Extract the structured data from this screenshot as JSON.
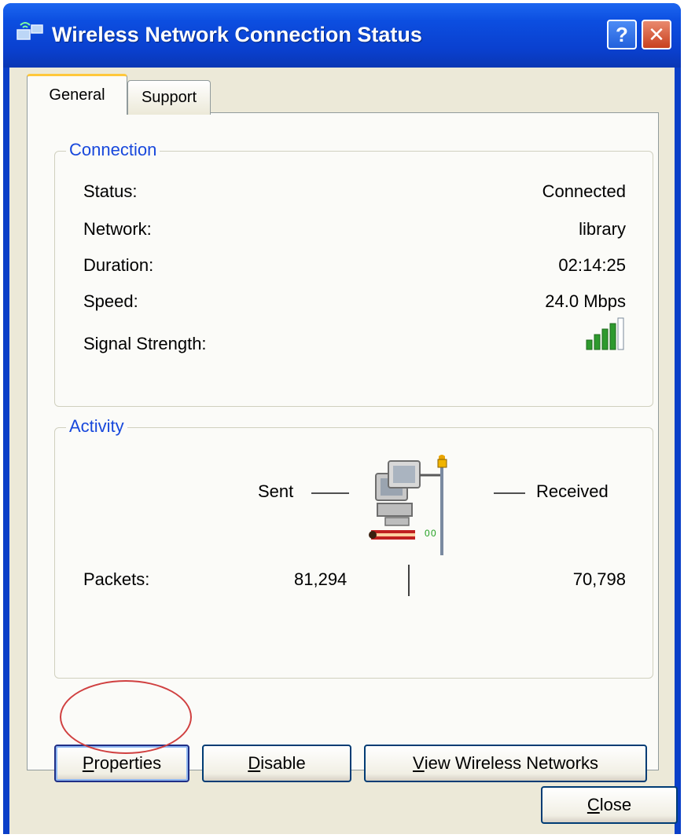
{
  "window": {
    "title": "Wireless Network Connection Status",
    "help_label": "?",
    "close_label": "✕"
  },
  "tabs": [
    {
      "label": "General",
      "selected": true
    },
    {
      "label": "Support",
      "selected": false
    }
  ],
  "connection": {
    "group_label": "Connection",
    "rows": [
      {
        "label": "Status:",
        "value": "Connected"
      },
      {
        "label": "Network:",
        "value": "library"
      },
      {
        "label": "Duration:",
        "value": "02:14:25"
      },
      {
        "label": "Speed:",
        "value": "24.0 Mbps"
      },
      {
        "label": "Signal Strength:",
        "value": ""
      }
    ],
    "signal_bars_lit": 4,
    "signal_bars_total": 5
  },
  "activity": {
    "group_label": "Activity",
    "sent_label": "Sent",
    "received_label": "Received",
    "packets_label": "Packets:",
    "packets_sent": "81,294",
    "packets_received": "70,798"
  },
  "buttons": {
    "properties": {
      "pre": "",
      "accel": "P",
      "post": "roperties"
    },
    "disable": {
      "pre": "",
      "accel": "D",
      "post": "isable"
    },
    "view_networks": {
      "pre": "",
      "accel": "V",
      "post": "iew Wireless Networks"
    },
    "close": {
      "pre": "",
      "accel": "C",
      "post": "lose"
    }
  },
  "colors": {
    "titlebar": "#0a40cf",
    "group_label": "#1848dc",
    "highlight_ring": "#d04040",
    "signal_green": "#2e9a2e"
  }
}
